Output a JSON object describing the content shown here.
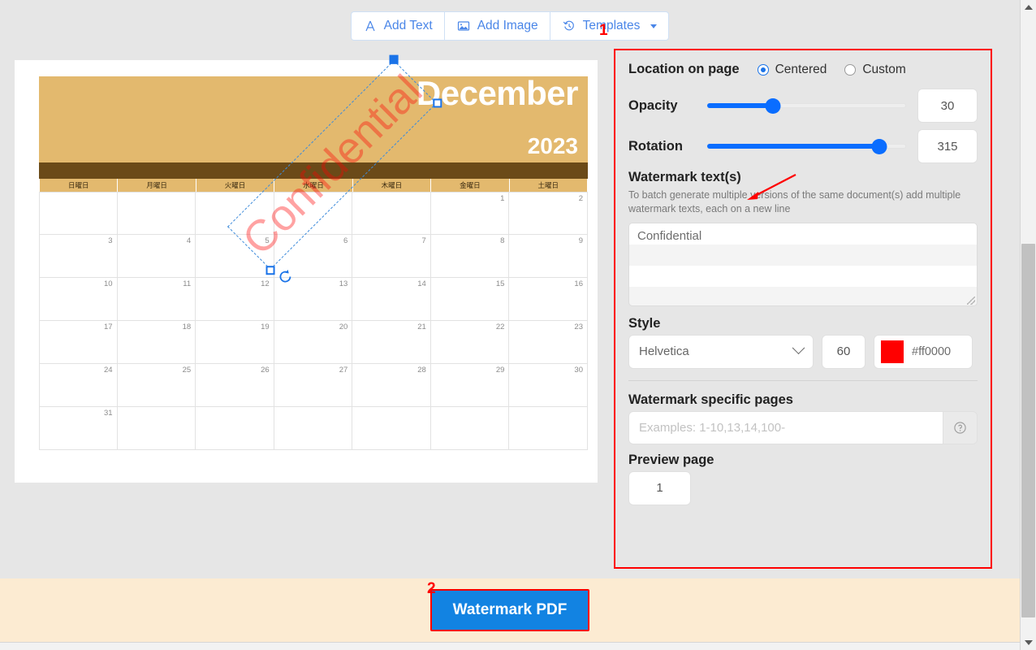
{
  "toolbar": {
    "buttons": [
      {
        "label": "Add Text",
        "icon": "text-a-icon"
      },
      {
        "label": "Add Image",
        "icon": "image-icon"
      },
      {
        "label": "Templates",
        "icon": "history-clock-icon"
      }
    ]
  },
  "document": {
    "calendar": {
      "month": "December",
      "year": "2023",
      "weekdays": [
        "日曜日",
        "月曜日",
        "火曜日",
        "水曜日",
        "木曜日",
        "金曜日",
        "土曜日"
      ],
      "days": [
        "",
        "",
        "",
        "",
        "",
        "1",
        "2",
        "3",
        "4",
        "5",
        "6",
        "7",
        "8",
        "9",
        "10",
        "11",
        "12",
        "13",
        "14",
        "15",
        "16",
        "17",
        "18",
        "19",
        "20",
        "21",
        "22",
        "23",
        "24",
        "25",
        "26",
        "27",
        "28",
        "29",
        "30",
        "31",
        "",
        "",
        "",
        "",
        "",
        ""
      ],
      "header_color": "#e3b96e",
      "band_color": "#6b4a18"
    },
    "watermark_preview": {
      "text": "Confidential",
      "color": "#ff0000",
      "opacity_display": "30"
    }
  },
  "panel": {
    "marker": "1",
    "location": {
      "label": "Location on page",
      "options": [
        {
          "label": "Centered",
          "selected": true
        },
        {
          "label": "Custom",
          "selected": false
        }
      ]
    },
    "opacity": {
      "label": "Opacity",
      "value": "30",
      "percent": 33
    },
    "rotation": {
      "label": "Rotation",
      "value": "315",
      "percent": 87
    },
    "watermark_texts": {
      "label": "Watermark text(s)",
      "hint": "To batch generate multiple versions of the same document(s) add multiple watermark texts, each on a new line",
      "value": "Confidential"
    },
    "style": {
      "label": "Style",
      "font": "Helvetica",
      "size": "60",
      "color_hex": "#ff0000"
    },
    "specific_pages": {
      "label": "Watermark specific pages",
      "placeholder": "Examples: 1-10,13,14,100-",
      "value": "",
      "help_icon": "question-circle-icon"
    },
    "preview_page": {
      "label": "Preview page",
      "value": "1"
    }
  },
  "footer": {
    "marker": "2",
    "submit_label": "Watermark PDF",
    "accent": "#1283e2"
  }
}
